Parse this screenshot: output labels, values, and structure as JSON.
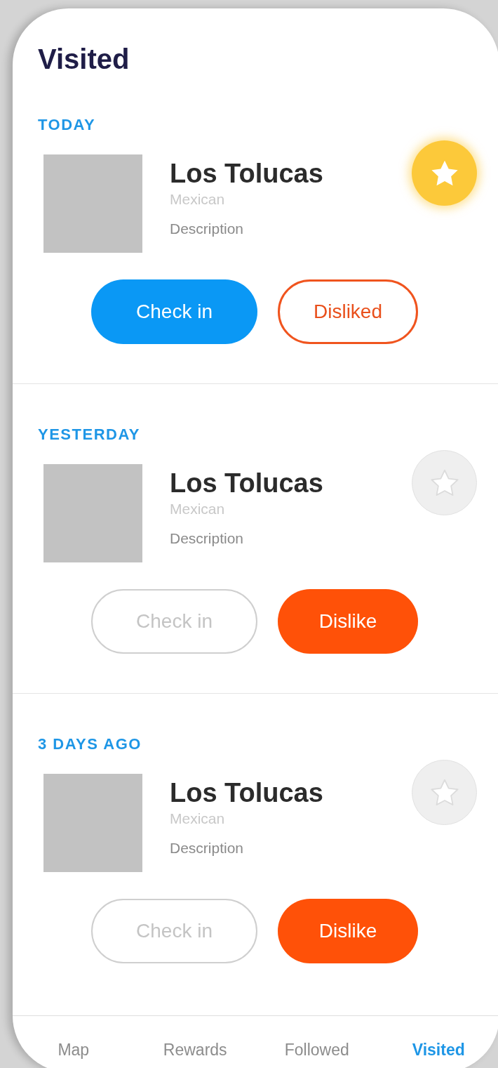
{
  "title": "Visited",
  "visits": [
    {
      "when": "TODAY",
      "name": "Los Tolucas",
      "cuisine": "Mexican",
      "description": "Description",
      "favorite": true,
      "checked_in": true,
      "check_in_label": "Check in",
      "disliked": true,
      "dislike_label": "Disliked"
    },
    {
      "when": "YESTERDAY",
      "name": "Los Tolucas",
      "cuisine": "Mexican",
      "description": "Description",
      "favorite": false,
      "checked_in": false,
      "check_in_label": "Check in",
      "disliked": false,
      "dislike_label": "Dislike"
    },
    {
      "when": "3 DAYS AGO",
      "name": "Los Tolucas",
      "cuisine": "Mexican",
      "description": "Description",
      "favorite": false,
      "checked_in": false,
      "check_in_label": "Check in",
      "disliked": false,
      "dislike_label": "Dislike"
    }
  ],
  "tabs": [
    {
      "label": "Map",
      "selected": false
    },
    {
      "label": "Rewards",
      "selected": false
    },
    {
      "label": "Followed",
      "selected": false
    },
    {
      "label": "Visited",
      "selected": true
    }
  ]
}
